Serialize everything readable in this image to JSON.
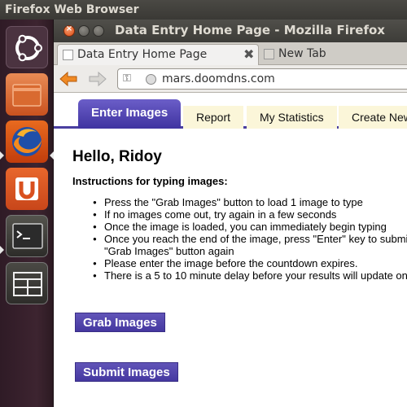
{
  "system": {
    "app_title": "Firefox Web Browser"
  },
  "launcher": {
    "items": [
      {
        "name": "dash",
        "icon": "ubuntu-logo-icon"
      },
      {
        "name": "files",
        "icon": "folder-icon"
      },
      {
        "name": "firefox",
        "icon": "firefox-icon"
      },
      {
        "name": "software-center",
        "icon": "ubuntu-one-icon"
      },
      {
        "name": "terminal",
        "icon": "terminal-icon",
        "glyph": ">_"
      },
      {
        "name": "workspaces",
        "icon": "workspace-switcher-icon"
      }
    ]
  },
  "window": {
    "title": "Data Entry Home Page - Mozilla Firefox",
    "tabs": [
      {
        "label": "Data Entry Home Page",
        "close": "✖",
        "active": true
      },
      {
        "label": "New Tab",
        "active": false
      }
    ],
    "url": "mars.doomdns.com"
  },
  "page": {
    "nav_tabs": [
      {
        "label": "Enter Images",
        "active": true
      },
      {
        "label": "Report"
      },
      {
        "label": "My Statistics"
      },
      {
        "label": "Create New"
      }
    ],
    "greeting": "Hello, Ridoy",
    "instructions_heading": "Instructions for typing images:",
    "instructions": [
      "Press the \"Grab Images\" button to load 1 image to type",
      "If no images come out, try again in a few seconds",
      "Once the image is loaded, you can immediately begin typing",
      "Once you reach the end of the image, press \"Enter\" key to submit",
      "\"Grab Images\" button again",
      "Please enter the image before the countdown expires.",
      "There is a 5 to 10 minute delay before your results will update on"
    ],
    "grab_button": "Grab Images",
    "submit_button": "Submit Images"
  },
  "colors": {
    "accent_purple": "#4a3fa0",
    "tab_bg": "#fbf6d9",
    "launcher_bg": "#3d2430"
  }
}
